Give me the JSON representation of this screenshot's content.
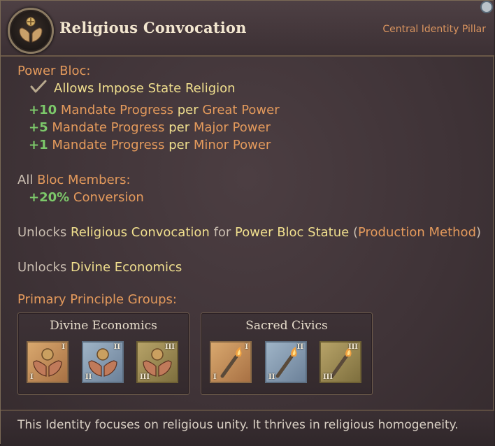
{
  "header": {
    "title": "Religious Convocation",
    "subtitle": "Central Identity Pillar",
    "emblem_icon": "praying-hands-emblem-icon"
  },
  "power_bloc": {
    "label": "Power Bloc:",
    "allows_text": "Allows Impose State Religion",
    "mandates": [
      {
        "amount": "+10",
        "text": "Mandate Progress",
        "per": "per",
        "target": "Great Power"
      },
      {
        "amount": "+5",
        "text": "Mandate Progress",
        "per": "per",
        "target": "Major Power"
      },
      {
        "amount": "+1",
        "text": "Mandate Progress",
        "per": "per",
        "target": "Minor Power"
      }
    ]
  },
  "bloc_members": {
    "prefix": "All",
    "label": "Bloc Members:",
    "amount": "+20%",
    "effect": "Conversion"
  },
  "unlocks": [
    {
      "prefix": "Unlocks",
      "name": "Religious Convocation",
      "for": "for",
      "building": "Power Bloc Statue",
      "open_paren": "(",
      "method": "Production Method",
      "close_paren": ")"
    },
    {
      "prefix": "Unlocks",
      "name": "Divine Economics"
    }
  ],
  "principles": {
    "label": "Primary Principle Groups:",
    "groups": [
      {
        "title": "Divine Economics",
        "icon": "praying-hands-icon",
        "tiers": [
          "I",
          "II",
          "III"
        ]
      },
      {
        "title": "Sacred Civics",
        "icon": "torch-icon",
        "tiers": [
          "I",
          "II",
          "III"
        ]
      }
    ]
  },
  "footer": {
    "text": "This Identity focuses on religious unity. It thrives in religious homogeneity."
  },
  "colors": {
    "accent_orange": "#e49a5c",
    "highlight_yellow": "#f0df8e",
    "positive_green": "#7cc86a"
  }
}
